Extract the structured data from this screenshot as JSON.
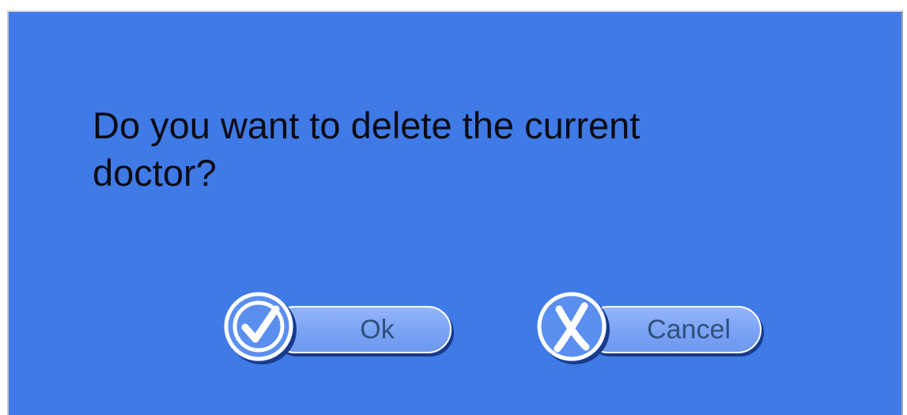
{
  "dialog": {
    "message": "Do you want to delete the current doctor?"
  },
  "buttons": {
    "ok": {
      "label": "Ok",
      "icon": "checkmark-icon"
    },
    "cancel": {
      "label": "Cancel",
      "icon": "x-icon"
    }
  },
  "colors": {
    "background": "#3f7ae6",
    "button_fill": "#7aa3f5",
    "button_text": "#2f4f7e",
    "shadow": "#173a8a",
    "text": "#0b0b14"
  }
}
